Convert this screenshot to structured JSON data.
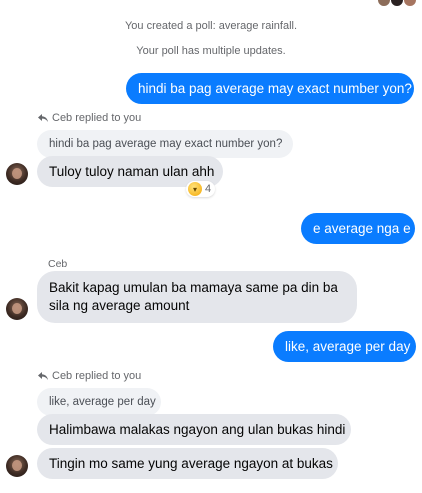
{
  "system_messages": {
    "poll_created": "You created a poll: average rainfall.",
    "poll_updates": "Your poll has multiple updates."
  },
  "messages": {
    "m1": "hindi ba pag average may exact number yon?",
    "reply1_label": "Ceb replied to you",
    "reply1_quote": "hindi ba pag average may exact number yon?",
    "m2": "Tuloy tuloy naman ulan ahh",
    "m2_reaction_count": "4",
    "m3": "e average nga e",
    "sender_name": "Ceb",
    "m4_line1": "Bakit kapag umulan ba mamaya same pa din ba",
    "m4_line2": "sila ng average amount",
    "m5": "like, average per day",
    "reply2_label": "Ceb replied to you",
    "reply2_quote": "like, average per day",
    "m6": "Halimbawa malakas ngayon ang ulan bukas hindi",
    "m7": "Tingin mo same yung average ngayon at bukas"
  },
  "colors": {
    "outgoing_bubble": "#0a7cff",
    "incoming_bubble": "#e4e6eb",
    "quoted_bubble": "#f0f2f5",
    "meta_text": "#65676b"
  },
  "icons": {
    "reply": "reply-arrow-icon",
    "reaction": "laughing-face-icon",
    "avatar": "contact-avatar"
  }
}
